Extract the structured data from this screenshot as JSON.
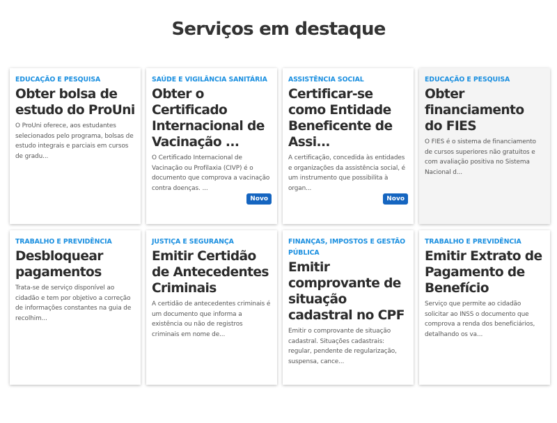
{
  "page": {
    "title": "Serviços em destaque"
  },
  "colors": {
    "category": "#1a8fe0",
    "title": "#2b2b2b",
    "badge_bg": "#1565c0"
  },
  "cards": [
    {
      "category": "EDUCAÇÃO E PESQUISA",
      "title": "Obter bolsa de estudo do ProUni",
      "description": "O ProUni oferece, aos estudantes selecionados pelo programa, bolsas de estudo integrais e parciais em cursos de gradu...",
      "badge": ""
    },
    {
      "category": "SAÚDE E VIGILÂNCIA SANITÁRIA",
      "title": "Obter o Certificado Internacional de Vacinação ...",
      "description": "O Certificado Internacional de Vacinação ou Profilaxia (CIVP) é o documento que comprova a vacinação contra doenças. ...",
      "badge": "Novo"
    },
    {
      "category": "ASSISTÊNCIA SOCIAL",
      "title": "Certificar-se como Entidade Beneficente de Assi...",
      "description": "A certificação, concedida às entidades e organizações da assistência social, é um instrumento que possibilita à organ...",
      "badge": "Novo"
    },
    {
      "category": "EDUCAÇÃO E PESQUISA",
      "title": "Obter financiamento do FIES",
      "description": "O FIES é o sistema de financiamento de cursos superiores não gratuitos e com avaliação positiva no Sistema Nacional d...",
      "badge": ""
    },
    {
      "category": "TRABALHO E PREVIDÊNCIA",
      "title": "Desbloquear pagamentos",
      "description": "Trata-se de serviço disponível ao cidadão e tem por objetivo a correção de informações constantes na guia de recolhim...",
      "badge": ""
    },
    {
      "category": "JUSTIÇA E SEGURANÇA",
      "title": "Emitir Certidão de Antecedentes Criminais",
      "description": "A certidão de antecedentes criminais é um documento que informa a existência ou não de registros criminais em nome de...",
      "badge": ""
    },
    {
      "category": "FINANÇAS, IMPOSTOS E GESTÃO PÚBLICA",
      "title": "Emitir comprovante de situação cadastral no CPF",
      "description": "Emitir o comprovante de situação cadastral. Situações cadastrais: regular, pendente de regularização, suspensa, cance...",
      "badge": ""
    },
    {
      "category": "TRABALHO E PREVIDÊNCIA",
      "title": "Emitir Extrato de Pagamento de Benefício",
      "description": "Serviço que permite ao cidadão solicitar ao INSS o documento que comprova a renda dos beneficiários, detalhando os va...",
      "badge": ""
    }
  ]
}
